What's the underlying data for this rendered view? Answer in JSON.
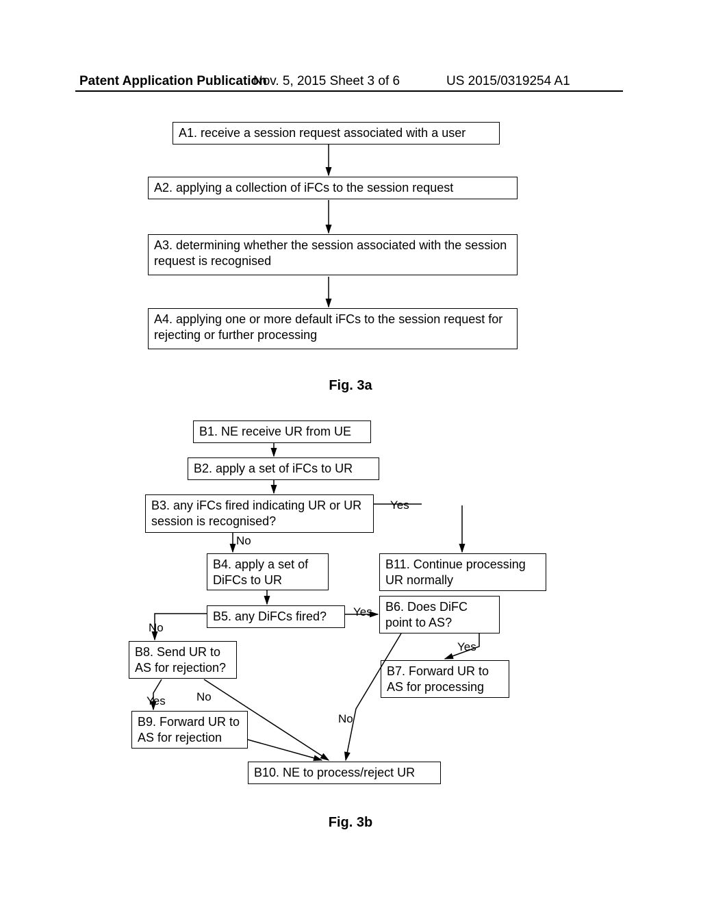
{
  "header": {
    "left": "Patent Application Publication",
    "mid": "Nov. 5, 2015   Sheet 3 of 6",
    "right": "US 2015/0319254 A1"
  },
  "fig3a": {
    "a1": "A1. receive a session request associated with a user",
    "a2": "A2. applying a collection of iFCs to the session request",
    "a3": "A3. determining whether the session associated with the session request is recognised",
    "a4": "A4. applying one or more default iFCs to the session request for rejecting or further processing",
    "caption": "Fig. 3a"
  },
  "fig3b": {
    "b1": "B1. NE receive UR from UE",
    "b2": "B2. apply a set of iFCs to UR",
    "b3": "B3. any iFCs fired indicating UR or UR session is recognised?",
    "b4": "B4. apply a set of DiFCs to UR",
    "b5": "B5. any DiFCs fired?",
    "b6": "B6. Does DiFC point to AS?",
    "b7": "B7. Forward UR to AS for processing",
    "b8": "B8. Send UR to AS for rejection?",
    "b9": "B9. Forward UR to AS for rejection",
    "b10": "B10. NE to process/reject UR",
    "b11": "B11. Continue processing UR normally",
    "yes": "Yes",
    "no": "No",
    "caption": "Fig. 3b"
  }
}
